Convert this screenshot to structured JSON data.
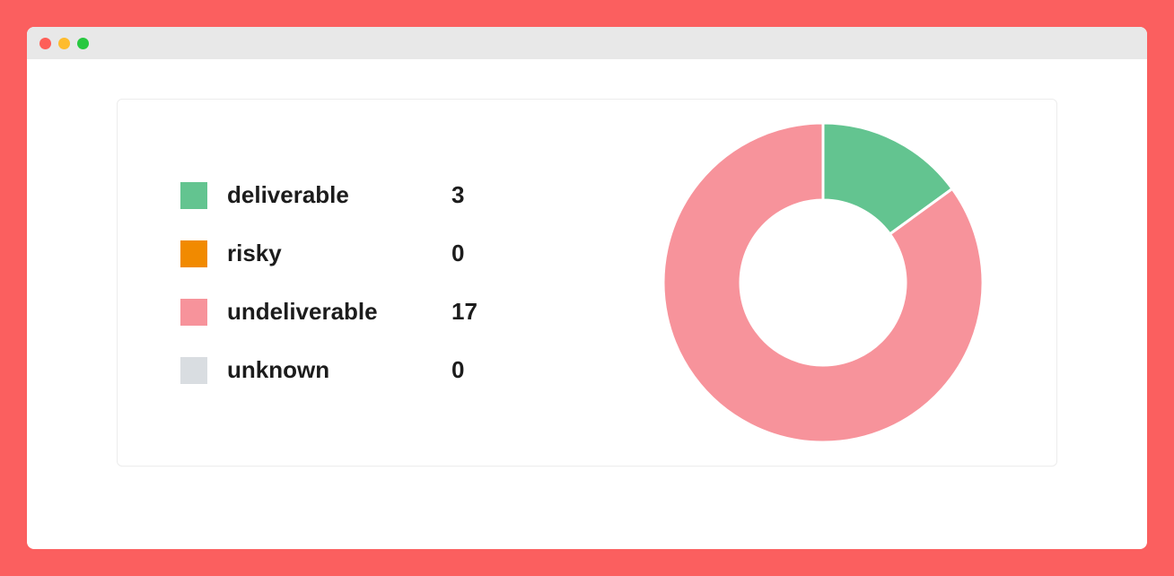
{
  "legend": [
    {
      "label": "deliverable",
      "value": 3,
      "color": "#63c490"
    },
    {
      "label": "risky",
      "value": 0,
      "color": "#f18a00"
    },
    {
      "label": "undeliverable",
      "value": 17,
      "color": "#f7939b"
    },
    {
      "label": "unknown",
      "value": 0,
      "color": "#d9dde1"
    }
  ],
  "chart_data": {
    "type": "pie",
    "title": "",
    "categories": [
      "deliverable",
      "risky",
      "undeliverable",
      "unknown"
    ],
    "values": [
      3,
      0,
      17,
      0
    ],
    "colors": [
      "#63c490",
      "#f18a00",
      "#f7939b",
      "#d9dde1"
    ]
  }
}
